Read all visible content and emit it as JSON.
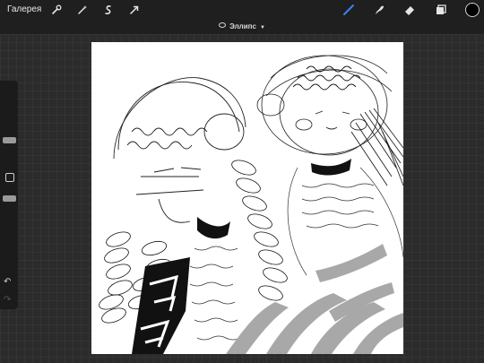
{
  "toolbar": {
    "gallery_label": "Галерея",
    "left_tools": [
      "wrench-icon",
      "magic-wand-icon",
      "selection-icon",
      "transform-arrow-icon"
    ],
    "right_tools": [
      "brush-icon",
      "smudge-icon",
      "eraser-icon",
      "layers-icon"
    ],
    "active_tool": "brush-icon",
    "active_color": "#000000",
    "accent_color": "#3b82f6"
  },
  "selection": {
    "mode_label": "Эллипс"
  },
  "sidebar": {
    "brush_size_level": 0.25,
    "opacity_level": 0.55
  }
}
